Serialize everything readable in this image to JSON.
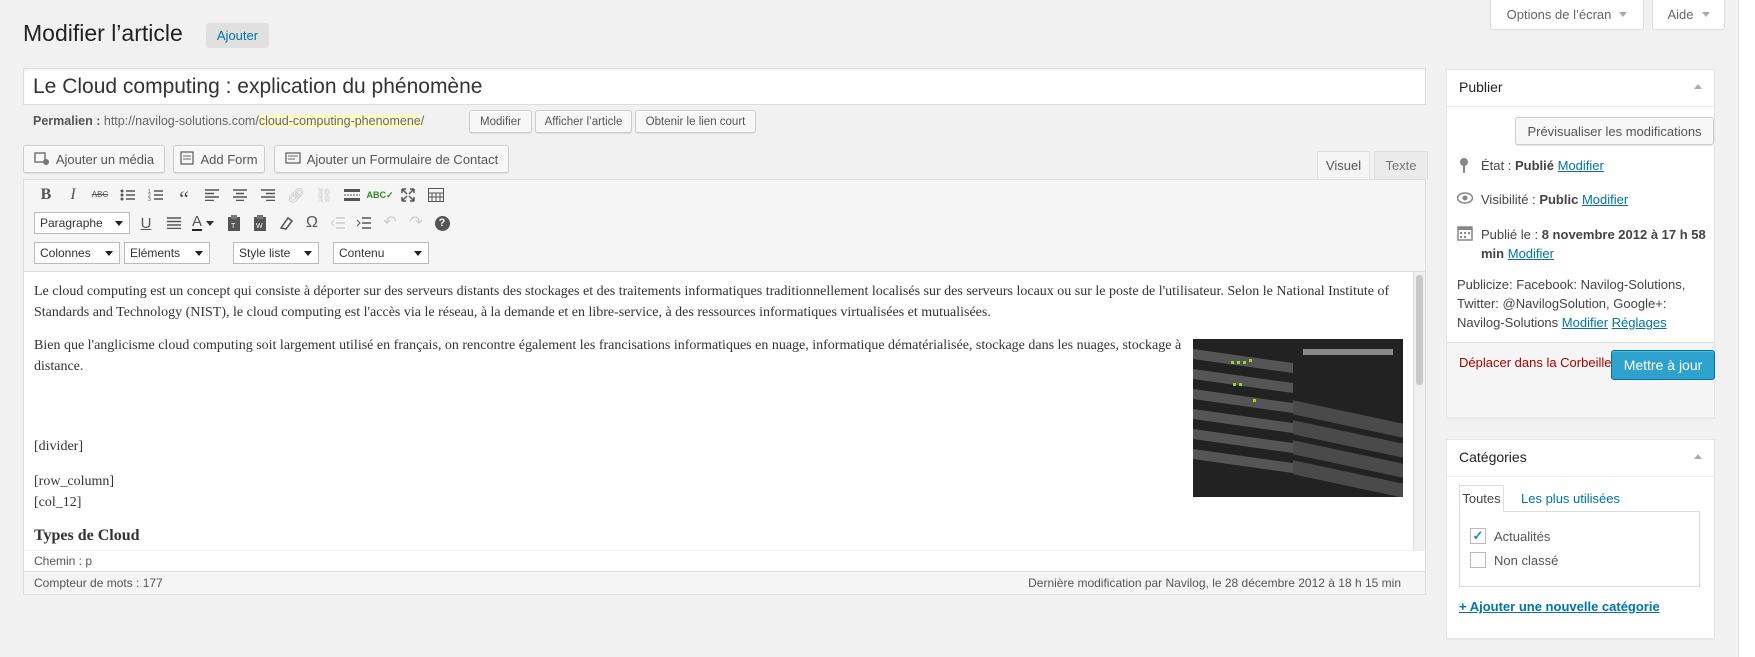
{
  "header": {
    "title": "Modifier l’article",
    "add_button": "Ajouter",
    "screen_options": "Options de l’écran",
    "help": "Aide"
  },
  "post": {
    "title": "Le Cloud computing : explication du phénomène",
    "permalink_label": "Permalien :",
    "permalink_base": "http://navilog-solutions.com/",
    "permalink_slug": "cloud-computing-phenomene",
    "permalink_trailing": "/",
    "permalink_buttons": {
      "edit": "Modifier",
      "view": "Afficher l’article",
      "shortlink": "Obtenir le lien court"
    }
  },
  "media_buttons": {
    "add_media": "Ajouter un média",
    "add_form": "Add Form",
    "add_contact_form": "Ajouter un Formulaire de Contact"
  },
  "editor_tabs": {
    "visual": "Visuel",
    "text": "Texte"
  },
  "toolbar": {
    "format_select": "Paragraphe",
    "columns_select": "Colonnes",
    "elements_select": "Eléments",
    "list_style_select": "Style liste",
    "content_select": "Contenu",
    "icons_row1": [
      "bold-icon",
      "italic-icon",
      "strikethrough-icon",
      "bullet-list-icon",
      "numbered-list-icon",
      "blockquote-icon",
      "align-left-icon",
      "align-center-icon",
      "align-right-icon",
      "link-icon",
      "unlink-icon",
      "more-tag-icon",
      "spellcheck-icon",
      "fullscreen-icon",
      "kitchen-sink-icon"
    ],
    "icons_row2": [
      "underline-icon",
      "justify-icon",
      "text-color-icon",
      "paste-text-icon",
      "paste-word-icon",
      "clear-format-icon",
      "special-char-icon",
      "outdent-icon",
      "indent-icon",
      "undo-icon",
      "redo-icon",
      "help-icon"
    ]
  },
  "content": {
    "p1": "Le cloud computing est un concept qui consiste à déporter sur des serveurs distants des stockages et des traitements informatiques traditionnellement localisés sur des serveurs locaux ou sur le poste de l'utilisateur. Selon le National Institute of Standards and Technology (NIST), le cloud computing est l'accès via le réseau, à la demande et en libre-service, à des ressources informatiques virtualisées et mutualisées.",
    "p2": "Bien que l'anglicisme cloud computing soit largement utilisé en français, on rencontre également les francisations informatiques en nuage, informatique dématérialisée, stockage dans les nuages, stockage à distance.",
    "divider": "[divider]",
    "row_column": "[row_column]",
    "col_12": "[col_12]",
    "cut_heading": "Types de Cloud"
  },
  "status_bar": {
    "path": "Chemin : p",
    "word_count": "Compteur de mots : 177",
    "last_modified": "Dernière modification par Navilog, le 28 décembre 2012 à 18 h 15 min"
  },
  "publish": {
    "title": "Publier",
    "preview": "Prévisualiser les modifications",
    "status_label": "État :",
    "status_value": "Publié",
    "visibility_label": "Visibilité :",
    "visibility_value": "Public",
    "published_label": "Publié le :",
    "published_value": "8 novembre 2012 à 17 h 58 min",
    "edit_link": "Modifier",
    "publicize_label": "Publicize:",
    "publicize_facebook": "Facebook: Navilog-Solutions",
    "publicize_twitter": "Twitter: @NavilogSolution",
    "publicize_google": "Google+: Navilog-Solutions",
    "settings_link": "Réglages",
    "trash": "Déplacer dans la Corbeille",
    "update": "Mettre à jour"
  },
  "categories": {
    "title": "Catégories",
    "tab_all": "Toutes",
    "tab_popular": "Les plus utilisées",
    "items": [
      {
        "label": "Actualités",
        "checked": true
      },
      {
        "label": "Non classé",
        "checked": false
      }
    ],
    "add_new": "+ Ajouter une nouvelle catégorie"
  },
  "colors": {
    "accent": "#2ea2cc",
    "link": "#0074a2",
    "trash": "#a00",
    "slug_highlight": "#fffbcc"
  }
}
